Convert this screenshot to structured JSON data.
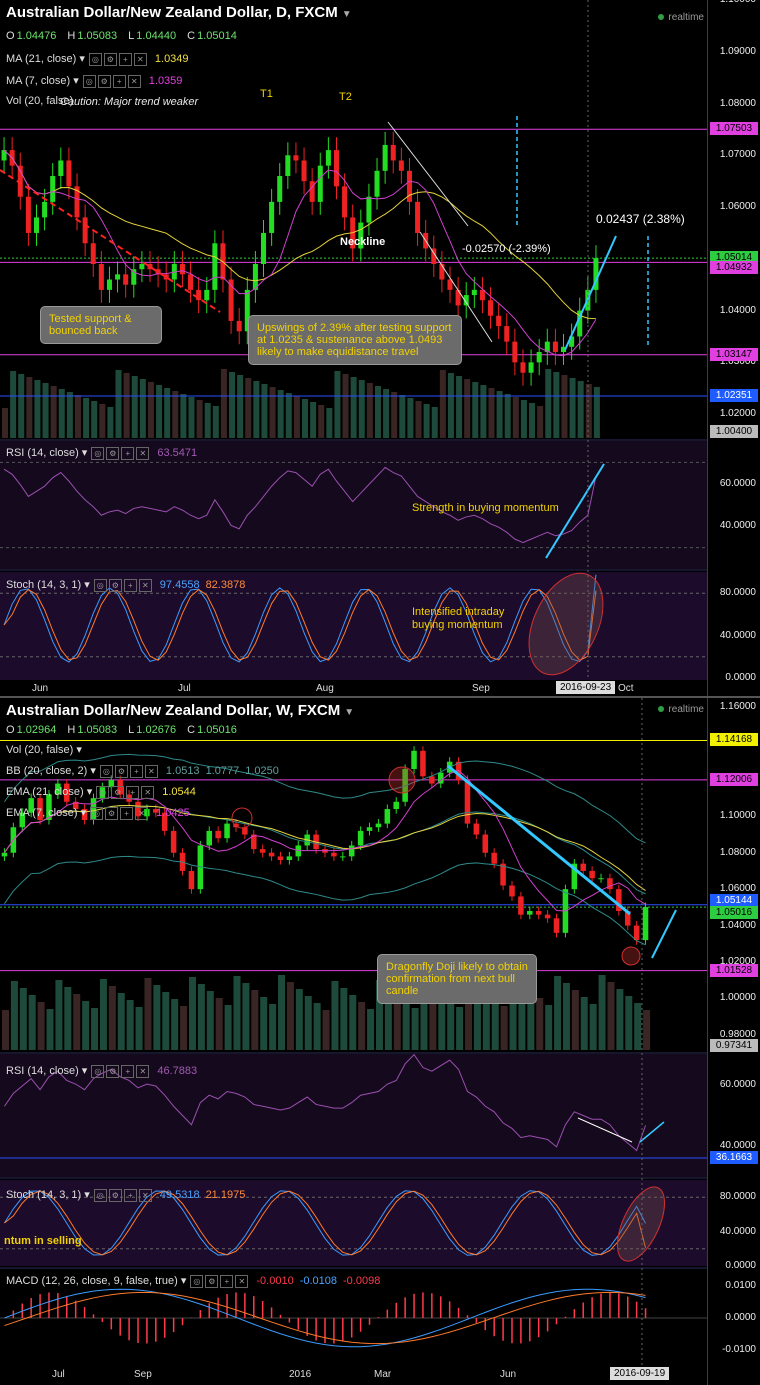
{
  "daily": {
    "title": "Australian Dollar/New Zealand Dollar, D, FXCM",
    "ohlc": {
      "o": "1.04476",
      "h": "1.05083",
      "l": "1.04440",
      "c": "1.05014"
    },
    "realtime": "realtime",
    "indicators": {
      "ma21": {
        "label": "MA (21, close)",
        "value": "1.0349"
      },
      "ma7": {
        "label": "MA (7, close)",
        "value": "1.0359"
      },
      "vol": {
        "label": "Vol (20, false)",
        "overlay": "Caution: Major trend weaker"
      },
      "rsi": {
        "label": "RSI (14, close)",
        "value": "63.5471"
      },
      "stoch": {
        "label": "Stoch (14, 3, 1)",
        "k": "97.4558",
        "d": "82.3878"
      }
    },
    "price_ticks": [
      "1.10000",
      "1.09000",
      "1.08000",
      "1.07000",
      "1.06000",
      "1.05000",
      "1.04000",
      "1.03000",
      "1.02000"
    ],
    "price_tags": [
      {
        "text": "1.07503",
        "color": "#e040e0"
      },
      {
        "text": "1.05014",
        "color": "#2ecc40"
      },
      {
        "text": "1.04932",
        "color": "#e040e0"
      },
      {
        "text": "1.03147",
        "color": "#e040e0"
      },
      {
        "text": "1.02351",
        "color": "#1e5cff"
      },
      {
        "text": "1.00400",
        "color": "#bbbbbb"
      }
    ],
    "rsi_ticks": [
      "60.0000",
      "40.0000"
    ],
    "stoch_ticks": [
      "80.0000",
      "40.0000",
      "0.0000"
    ],
    "x_labels": [
      "Jun",
      "Jul",
      "Aug",
      "Sep",
      "Oct"
    ],
    "date_tag": "2016-09-23",
    "annotations": {
      "t1": "T1",
      "t2": "T2",
      "neckline": "Neckline",
      "drop": "-0.02570 (-2.39%)",
      "rise": "0.02437 (2.38%)",
      "callout1": "Tested support & bounced back",
      "callout2": "Upswings of 2.39% after testing support at 1.0235 & sustenance above 1.0493 likely to make equidistance travel",
      "rsi_note": "Strength in buying momentum",
      "stoch_note": "Intensified intraday buying momentum"
    }
  },
  "weekly": {
    "title": "Australian Dollar/New Zealand Dollar, W, FXCM",
    "ohlc": {
      "o": "1.02964",
      "h": "1.05083",
      "l": "1.02676",
      "c": "1.05016"
    },
    "realtime": "realtime",
    "indicators": {
      "vol": {
        "label": "Vol (20, false)"
      },
      "bb": {
        "label": "BB (20, close, 2)",
        "v1": "1.0513",
        "v2": "1.0777",
        "v3": "1.0250"
      },
      "ema21": {
        "label": "EMA (21, close)",
        "value": "1.0544"
      },
      "ema7": {
        "label": "EMA (7, close)",
        "value": "1.0425"
      },
      "rsi": {
        "label": "RSI (14, close)",
        "value": "46.7883"
      },
      "stoch": {
        "label": "Stoch (14, 3, 1)",
        "k": "49.5318",
        "d": "21.1975",
        "overlay": "ntum in selling"
      },
      "macd": {
        "label": "MACD (12, 26, close, 9, false, true)",
        "v1": "-0.0010",
        "v2": "-0.0108",
        "v3": "-0.0098"
      }
    },
    "price_ticks": [
      "1.16000",
      "1.14000",
      "1.12000",
      "1.10000",
      "1.08000",
      "1.06000",
      "1.04000",
      "1.02000",
      "1.00000",
      "0.98000"
    ],
    "price_tags": [
      {
        "text": "1.14168",
        "color": "#f0f000"
      },
      {
        "text": "1.12006",
        "color": "#e040e0"
      },
      {
        "text": "1.05144",
        "color": "#1e5cff"
      },
      {
        "text": "1.05016",
        "color": "#2ecc40"
      },
      {
        "text": "1.01528",
        "color": "#e040e0"
      },
      {
        "text": "0.97341",
        "color": "#bbbbbb"
      }
    ],
    "rsi_ticks": [
      "60.0000",
      "40.0000"
    ],
    "rsi_tag": {
      "text": "36.1663",
      "color": "#1e5cff"
    },
    "stoch_ticks": [
      "80.0000",
      "40.0000",
      "0.0000"
    ],
    "macd_ticks": [
      "0.0100",
      "0.0000",
      "-0.0100"
    ],
    "x_labels": [
      "Jul",
      "Sep",
      "2016",
      "Mar",
      "Jun"
    ],
    "date_tag": "2016-09-19",
    "annotations": {
      "callout": "Dragonfly Doji likely to obtain confirmation from next bull candle"
    }
  },
  "chart_data": [
    {
      "type": "candlestick",
      "title": "Australian Dollar/New Zealand Dollar, D, FXCM",
      "timeframe": "D",
      "ylim": [
        1.015,
        1.1
      ],
      "x_labels": [
        "Jun",
        "Jul",
        "Aug",
        "Sep",
        "Oct"
      ],
      "last_close": 1.05014,
      "close_series_approx": [
        1.071,
        1.068,
        1.062,
        1.055,
        1.058,
        1.061,
        1.066,
        1.069,
        1.064,
        1.058,
        1.053,
        1.049,
        1.044,
        1.046,
        1.047,
        1.045,
        1.048,
        1.049,
        1.048,
        1.047,
        1.046,
        1.049,
        1.047,
        1.044,
        1.042,
        1.044,
        1.053,
        1.046,
        1.038,
        1.036,
        1.044,
        1.049,
        1.055,
        1.061,
        1.066,
        1.07,
        1.069,
        1.065,
        1.061,
        1.068,
        1.071,
        1.064,
        1.058,
        1.052,
        1.057,
        1.062,
        1.067,
        1.072,
        1.069,
        1.067,
        1.061,
        1.055,
        1.052,
        1.049,
        1.046,
        1.044,
        1.041,
        1.043,
        1.044,
        1.042,
        1.039,
        1.037,
        1.034,
        1.03,
        1.028,
        1.03,
        1.032,
        1.034,
        1.032,
        1.033,
        1.035,
        1.04,
        1.044,
        1.05014
      ],
      "levels": [
        1.07503,
        1.04932,
        1.03147,
        1.02351
      ],
      "ma21_last": 1.0349,
      "ma7_last": 1.0359,
      "rsi": {
        "last": 63.5471,
        "ylim": [
          20,
          80
        ]
      },
      "stoch": {
        "k_last": 97.4558,
        "d_last": 82.3878,
        "ylim": [
          0,
          100
        ]
      }
    },
    {
      "type": "candlestick",
      "title": "Australian Dollar/New Zealand Dollar, W, FXCM",
      "timeframe": "W",
      "ylim": [
        0.97,
        1.165
      ],
      "x_labels": [
        "Jul",
        "Sep",
        "2016",
        "Mar",
        "Jun"
      ],
      "last_close": 1.05016,
      "close_series_approx": [
        1.08,
        1.094,
        1.102,
        1.11,
        1.098,
        1.112,
        1.118,
        1.108,
        1.104,
        1.098,
        1.11,
        1.116,
        1.12,
        1.112,
        1.108,
        1.1,
        1.104,
        1.102,
        1.092,
        1.08,
        1.07,
        1.06,
        1.084,
        1.092,
        1.088,
        1.096,
        1.094,
        1.09,
        1.082,
        1.08,
        1.078,
        1.076,
        1.078,
        1.084,
        1.09,
        1.082,
        1.08,
        1.078,
        1.078,
        1.084,
        1.092,
        1.094,
        1.096,
        1.104,
        1.108,
        1.126,
        1.136,
        1.122,
        1.118,
        1.124,
        1.13,
        1.12,
        1.096,
        1.09,
        1.08,
        1.074,
        1.062,
        1.056,
        1.046,
        1.048,
        1.046,
        1.044,
        1.036,
        1.06,
        1.074,
        1.07,
        1.066,
        1.066,
        1.06,
        1.048,
        1.04,
        1.032,
        1.05016
      ],
      "levels": [
        1.14168,
        1.12006,
        1.05144,
        1.01528
      ],
      "bb_last": [
        1.0513,
        1.0777,
        1.025
      ],
      "ema21_last": 1.0544,
      "ema7_last": 1.0425,
      "rsi": {
        "last": 46.7883,
        "level": 36.1663,
        "ylim": [
          30,
          70
        ]
      },
      "stoch": {
        "k_last": 49.5318,
        "d_last": 21.1975,
        "ylim": [
          0,
          100
        ]
      },
      "macd": {
        "values": [
          -0.001,
          -0.0108,
          -0.0098
        ],
        "ylim": [
          -0.015,
          0.015
        ]
      }
    }
  ]
}
